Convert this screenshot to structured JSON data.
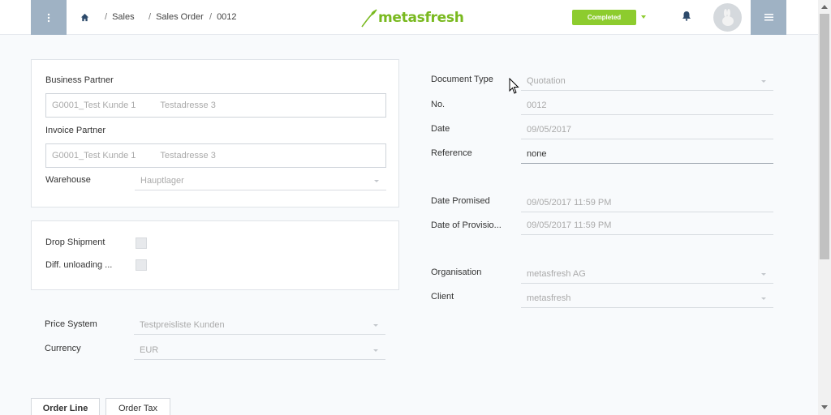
{
  "header": {
    "breadcrumb": [
      {
        "label": "Sales"
      },
      {
        "label": "Sales Order"
      },
      {
        "label": "0012"
      }
    ],
    "logo": "metasfresh",
    "status": "Completed",
    "icons": [
      "kebab-menu-icon",
      "home-icon",
      "bell-icon",
      "avatar-rabbit-icon",
      "hamburger-menu-icon"
    ]
  },
  "partner_panel": {
    "business_partner_label": "Business Partner",
    "business_partner_value": "G0001_Test Kunde 1",
    "business_partner_address": "Testadresse 3",
    "invoice_partner_label": "Invoice Partner",
    "invoice_partner_value": "G0001_Test Kunde 1",
    "invoice_partner_address": "Testadresse 3",
    "warehouse_label": "Warehouse",
    "warehouse_value": "Hauptlager"
  },
  "shipment_panel": {
    "drop_shipment_label": "Drop Shipment",
    "diff_unloading_label": "Diff. unloading ..."
  },
  "pricing": {
    "price_system_label": "Price System",
    "price_system_value": "Testpreisliste Kunden",
    "currency_label": "Currency",
    "currency_value": "EUR"
  },
  "document": {
    "document_type_label": "Document Type",
    "document_type_value": "Quotation",
    "no_label": "No.",
    "no_value": "0012",
    "date_label": "Date",
    "date_value": "09/05/2017",
    "reference_label": "Reference",
    "reference_value": "none",
    "date_promised_label": "Date Promised",
    "date_promised_value": "09/05/2017 11:59 PM",
    "date_provision_label": "Date of Provisio...",
    "date_provision_value": "09/05/2017 11:59 PM",
    "organisation_label": "Organisation",
    "organisation_value": "metasfresh AG",
    "client_label": "Client",
    "client_value": "metasfresh"
  },
  "tabs": [
    {
      "label": "Order Line"
    },
    {
      "label": "Order Tax"
    }
  ],
  "colors": {
    "brand": "#79b91f",
    "status": "#8dcc2e",
    "header_button": "#9fb2c4",
    "background": "#f8fafc"
  }
}
